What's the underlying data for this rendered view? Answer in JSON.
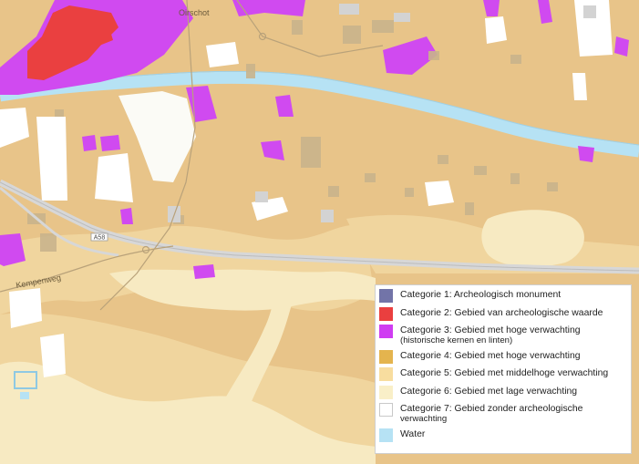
{
  "map": {
    "labels": {
      "town": "Oirschot",
      "street": "Kempenweg",
      "road_number": "A58"
    }
  },
  "legend": {
    "items": [
      {
        "label": "Categorie 1: Archeologisch monument",
        "sub": "",
        "color": "#7274a8"
      },
      {
        "label": "Categorie 2: Gebied van archeologische waarde",
        "sub": "",
        "color": "#ea3f3f"
      },
      {
        "label": "Categorie 3: Gebied met hoge verwachting",
        "sub": "(historische kernen en linten)",
        "color": "#cf3cf2"
      },
      {
        "label": "Categorie 4: Gebied met hoge verwachting",
        "sub": "",
        "color": "#e4b44e"
      },
      {
        "label": "Categorie 5: Gebied met middelhoge verwachting",
        "sub": "",
        "color": "#f8dd9f"
      },
      {
        "label": "Categorie 6: Gebied met lage verwachting",
        "sub": "",
        "color": "#f9efc8"
      },
      {
        "label": "Categorie 7: Gebied zonder archeologische",
        "sub": "verwachting",
        "color": "#ffffff"
      },
      {
        "label": "Water",
        "sub": "",
        "color": "#b6e2f4"
      }
    ]
  }
}
